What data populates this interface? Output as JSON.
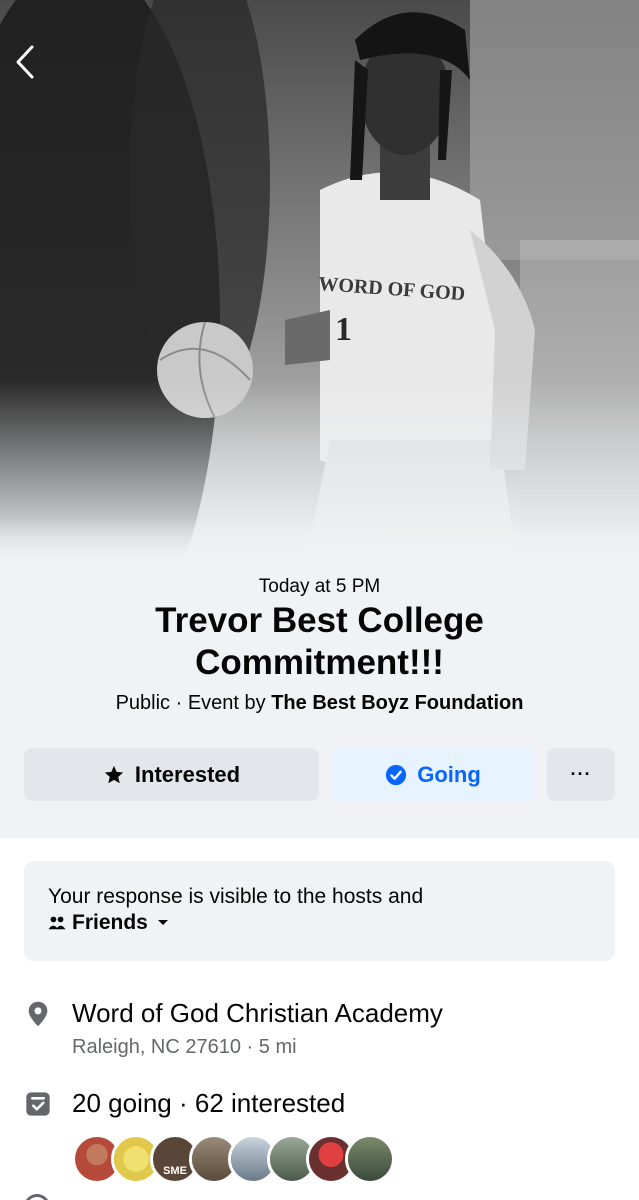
{
  "header": {
    "back_icon": "chevron-left-icon"
  },
  "event": {
    "date": "Today at 5 PM",
    "title": "Trevor Best College Commitment!!!",
    "privacy": "Public",
    "event_by_prefix": "Event by",
    "host": "The Best Boyz Foundation",
    "jersey_text": "WORD OF GOD",
    "jersey_number": "1"
  },
  "actions": {
    "interested_label": "Interested",
    "interested_icon": "star-icon",
    "going_label": "Going",
    "going_icon": "check-circle-icon",
    "more_label": "···"
  },
  "notice": {
    "text": "Your response is visible to the hosts and",
    "audience": "Friends",
    "audience_icon": "friends-icon"
  },
  "location": {
    "name": "Word of God Christian Academy",
    "sub": "Raleigh, NC 27610 · 5 mi",
    "icon": "location-pin-icon"
  },
  "attendance": {
    "text": "20 going · 62 interested",
    "icon": "calendar-check-icon",
    "avatar_count": 8,
    "avatar_colors": [
      "#b54a3a",
      "#e0c84a",
      "#5a4636",
      "#7a6a5a",
      "#8a9aa8",
      "#6a7a6a",
      "#a53030",
      "#4a5a4a"
    ],
    "avatar_inner_text": "SME"
  },
  "colors": {
    "accent": "#0866ff",
    "accent_bg": "#e7f3ff",
    "secondary_text": "#65676b",
    "button_bg": "#e4e6eb",
    "panel_bg": "#f0f2f5"
  }
}
